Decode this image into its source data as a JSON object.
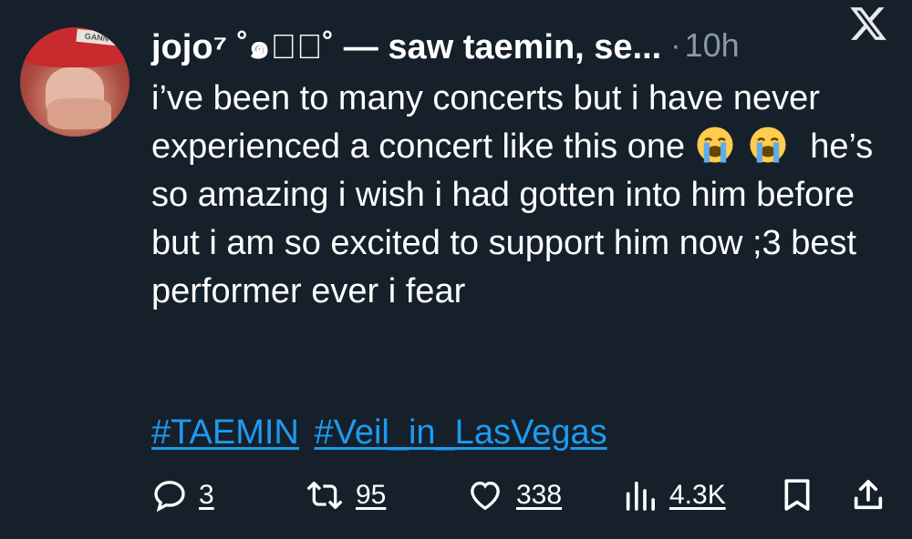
{
  "user": {
    "display_name": "jojo⁷ ˚๑♡้˚ — saw taemin, se...",
    "separator": "·",
    "time": "10h"
  },
  "tweet": {
    "text_part1": "i’ve been to many concerts but i have never experienced a concert like this one ",
    "emoji": "loudly-crying-face-icon",
    "text_part2": "he’s so amazing i wish i had gotten into him before but i am so excited to support him now ;3 best performer ever i fear",
    "hashtags": [
      "#TAEMIN",
      "#Veil_in_LasVegas"
    ]
  },
  "actions": {
    "replies": "3",
    "reposts": "95",
    "likes": "338",
    "views": "4.3K"
  },
  "colors": {
    "background": "#15202b",
    "secondary_text": "#8b98a5",
    "link": "#1d9bf0"
  }
}
